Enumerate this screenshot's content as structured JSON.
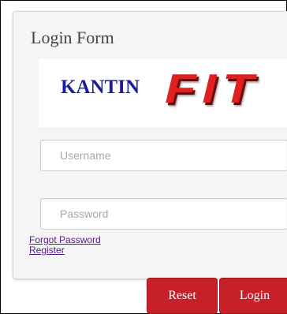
{
  "form": {
    "title": "Login Form",
    "logo": {
      "word1": "KANTIN",
      "word2": "FIT"
    },
    "username": {
      "value": "",
      "placeholder": "Username"
    },
    "password": {
      "value": "",
      "placeholder": "Password"
    },
    "links": {
      "forgot": "Forgot Password",
      "register": "Register"
    },
    "buttons": {
      "reset": "Reset",
      "login": "Login"
    }
  },
  "colors": {
    "accent_red": "#c6202a",
    "logo_blue": "#1b1d9e",
    "logo_red": "#e02020",
    "link_purple": "#551a8b"
  }
}
